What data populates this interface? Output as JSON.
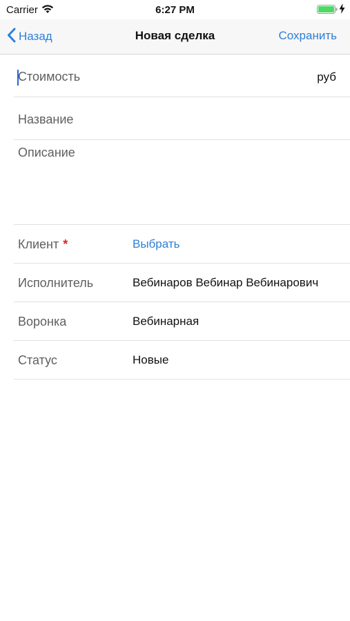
{
  "status_bar": {
    "carrier": "Carrier",
    "time": "6:27 PM",
    "battery_color": "#4cd964"
  },
  "nav": {
    "back_label": "Назад",
    "title": "Новая сделка",
    "save_label": "Сохранить",
    "accent_color": "#2b7fd9"
  },
  "form": {
    "cost": {
      "placeholder": "Стоимость",
      "unit": "руб"
    },
    "name": {
      "placeholder": "Название"
    },
    "description": {
      "placeholder": "Описание"
    },
    "client": {
      "label": "Клиент",
      "required_mark": "*",
      "value": "Выбрать"
    },
    "executor": {
      "label": "Исполнитель",
      "value": "Вебинаров Вебинар Вебинарович"
    },
    "funnel": {
      "label": "Воронка",
      "value": "Вебинарная"
    },
    "status": {
      "label": "Статус",
      "value": "Новые"
    }
  }
}
